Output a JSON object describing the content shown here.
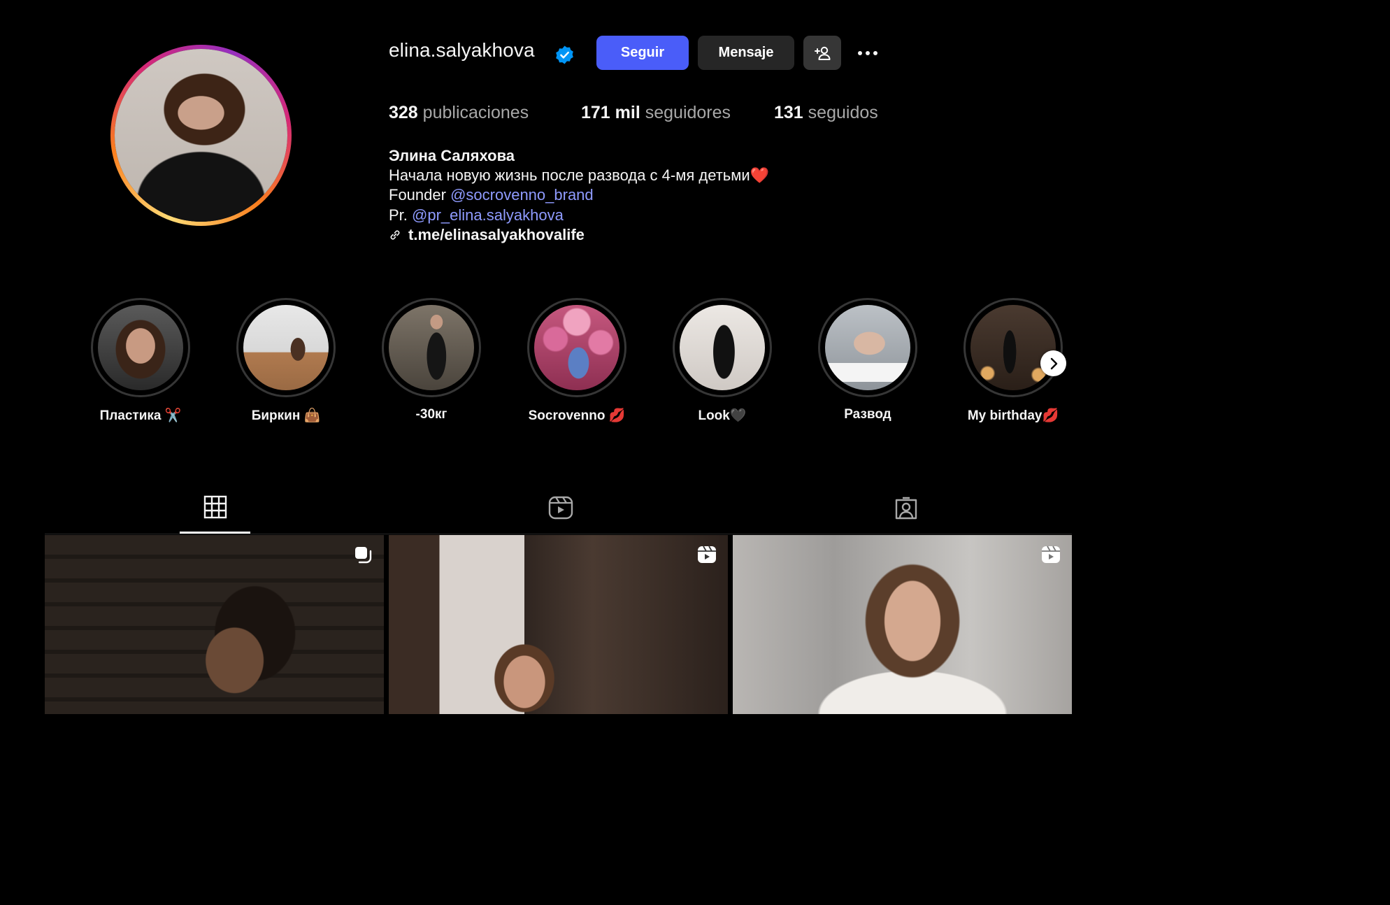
{
  "profile": {
    "username": "elina.salyakhova",
    "verified_icon": "verified-badge-icon",
    "follow_label": "Seguir",
    "message_label": "Mensaje",
    "adduser_icon": "add-user-icon",
    "more_icon": "more-options-icon"
  },
  "stats": {
    "posts_count": "328",
    "posts_label": "publicaciones",
    "followers_count": "171 mil",
    "followers_label": "seguidores",
    "following_count": "131",
    "following_label": "seguidos"
  },
  "bio": {
    "name": "Элина Саляхова",
    "description": "Начала новую жизнь после развода с 4-мя детьми❤️",
    "founder_prefix": "Founder",
    "founder_mention": "@socrovenno_brand",
    "pr_prefix": "Pr.",
    "pr_mention": "@pr_elina.salyakhova",
    "link": "t.me/elinasalyakhovalife"
  },
  "highlights": [
    {
      "label": "Пластика ✂️"
    },
    {
      "label": "Биркин 👜"
    },
    {
      "label": "-30кг"
    },
    {
      "label": "Socrovenno 💋"
    },
    {
      "label": "Look🖤"
    },
    {
      "label": "Развод"
    },
    {
      "label": "My birthday💋"
    }
  ],
  "highlights_next_icon": "chevron-right-icon",
  "tabs": [
    {
      "icon": "grid-icon",
      "active": true
    },
    {
      "icon": "reels-icon",
      "active": false
    },
    {
      "icon": "tagged-icon",
      "active": false
    }
  ],
  "posts": [
    {
      "badge": "carousel-icon"
    },
    {
      "badge": "reel-icon"
    },
    {
      "badge": "reel-icon"
    }
  ],
  "colors": {
    "background": "#000000",
    "follow_button": "#4a5df9",
    "secondary_button": "#262626",
    "mention": "#8f9bff",
    "muted_text": "#a8a8a8",
    "verified": "#0095f6"
  }
}
